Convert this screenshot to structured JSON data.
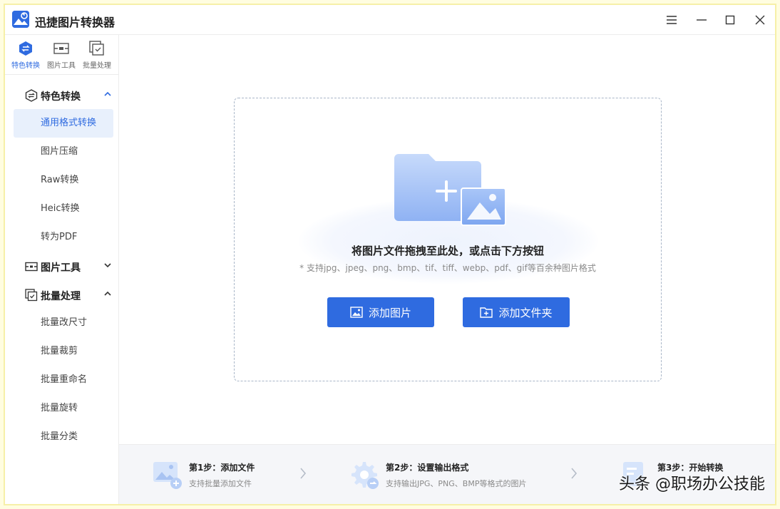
{
  "app": {
    "title": "迅捷图片转换器"
  },
  "top_tabs": [
    {
      "label": "特色转换"
    },
    {
      "label": "图片工具"
    },
    {
      "label": "批量处理"
    }
  ],
  "sections": {
    "special": {
      "label": "特色转换",
      "items": [
        "通用格式转换",
        "图片压缩",
        "Raw转换",
        "Heic转换",
        "转为PDF"
      ]
    },
    "tools": {
      "label": "图片工具"
    },
    "batch": {
      "label": "批量处理",
      "items": [
        "批量改尺寸",
        "批量裁剪",
        "批量重命名",
        "批量旋转",
        "批量分类"
      ]
    }
  },
  "drop_zone": {
    "title": "将图片文件拖拽至此处，或点击下方按钮",
    "subtitle": "* 支持jpg、jpeg、png、bmp、tif、tiff、webp、pdf、gif等百余种图片格式",
    "add_image_label": "添加图片",
    "add_folder_label": "添加文件夹"
  },
  "steps": [
    {
      "title": "第1步：添加文件",
      "desc": "支持批量添加文件"
    },
    {
      "title": "第2步：设置输出格式",
      "desc": "支持输出JPG、PNG、BMP等格式的图片"
    },
    {
      "title": "第3步：开始转换",
      "desc": ""
    }
  ],
  "watermark": "头条 @职场办公技能",
  "colors": {
    "accent": "#2f6be0",
    "active_bg": "#e8f0fc"
  }
}
